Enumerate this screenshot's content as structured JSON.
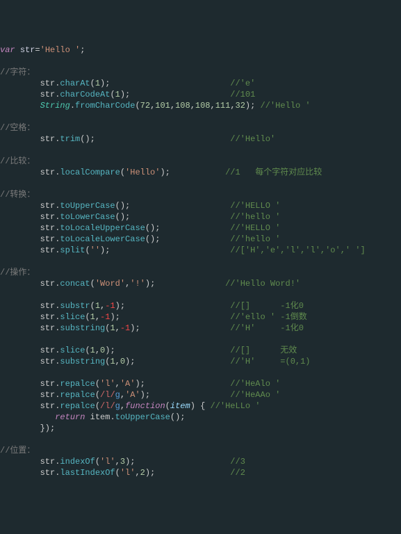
{
  "l1": {
    "kw": "var",
    "sp": " ",
    "id": "str",
    "op": "=",
    "str": "'Hello '",
    "end": ";"
  },
  "c1": "//字符：",
  "l2": {
    "pre": "        str.",
    "m": "charAt",
    "args": "(",
    "n": "1",
    "rest": ");",
    "pad": "                        ",
    "cmt": "//'e'"
  },
  "l3": {
    "pre": "        str.",
    "m": "charCodeAt",
    "args": "(",
    "n": "1",
    "rest": ");",
    "pad": "                    ",
    "cmt": "//101"
  },
  "l4": {
    "pre": "        ",
    "cls": "String",
    "dot": ".",
    "m": "fromCharCode",
    "a": "(",
    "n1": "72",
    "c": ",",
    "n2": "101",
    "n3": "108",
    "n4": "108",
    "n5": "111",
    "n6": "32",
    "rest": "); ",
    "cmt": "//'Hello '"
  },
  "c2": "//空格：",
  "l5": {
    "pre": "        str.",
    "m": "trim",
    "rest": "();",
    "pad": "                           ",
    "cmt": "//'Hello'"
  },
  "c3": "//比较：",
  "l6": {
    "pre": "        str.",
    "m": "localCompare",
    "a": "(",
    "s": "'Hello'",
    "rest": ");",
    "pad": "           ",
    "cmt": "//1   每个字符对应比较"
  },
  "c4": "//转换：",
  "l7": {
    "pre": "        str.",
    "m": "toUpperCase",
    "rest": "();",
    "pad": "                    ",
    "cmt": "//'HELLO '"
  },
  "l8": {
    "pre": "        str.",
    "m": "toLowerCase",
    "rest": "();",
    "pad": "                    ",
    "cmt": "//'hello '"
  },
  "l9": {
    "pre": "        str.",
    "m": "toLocaleUpperCase",
    "rest": "();",
    "pad": "              ",
    "cmt": "//'HELLO '"
  },
  "l10": {
    "pre": "        str.",
    "m": "toLocaleLowerCase",
    "rest": "();",
    "pad": "              ",
    "cmt": "//'hello '"
  },
  "l11": {
    "pre": "        str.",
    "m": "split",
    "a": "(",
    "s": "''",
    "rest": ");",
    "pad": "                        ",
    "cmt": "//['H','e','l','l','o',' ']"
  },
  "c5": "//操作：",
  "l12": {
    "pre": "        str.",
    "m": "concat",
    "a": "(",
    "s1": "'Word'",
    "c": ",",
    "s2": "'!'",
    "rest": ");",
    "pad": "              ",
    "cmt": "//'Hello Word!'"
  },
  "l13": {
    "pre": "        str.",
    "m": "substr",
    "a": "(",
    "n1": "1",
    "c": ",",
    "neg": "-1",
    "rest": ");",
    "pad": "                     ",
    "cmt": "//[]      -1化0"
  },
  "l14": {
    "pre": "        str.",
    "m": "slice",
    "a": "(",
    "n1": "1",
    "c": ",",
    "neg": "-1",
    "rest": ");",
    "pad": "                      ",
    "cmt": "//'ello ' -1倒数"
  },
  "l15": {
    "pre": "        str.",
    "m": "substring",
    "a": "(",
    "n1": "1",
    "c": ",",
    "neg": "-1",
    "rest": ");",
    "pad": "                  ",
    "cmt": "//'H'     -1化0"
  },
  "l16": {
    "pre": "        str.",
    "m": "slice",
    "a": "(",
    "n1": "1",
    "c": ",",
    "n2": "0",
    "rest": ");",
    "pad": "                       ",
    "cmt": "//[]      无效"
  },
  "l17": {
    "pre": "        str.",
    "m": "substring",
    "a": "(",
    "n1": "1",
    "c": ",",
    "n2": "0",
    "rest": ");",
    "pad": "                   ",
    "cmt": "//'H'     =(0,1)"
  },
  "l18": {
    "pre": "        str.",
    "m": "repalce",
    "a": "(",
    "s1": "'l'",
    "c": ",",
    "s2": "'A'",
    "rest": ");",
    "pad": "                 ",
    "cmt": "//'HeAlo '"
  },
  "l19": {
    "pre": "        str.",
    "m": "repalce",
    "a": "(",
    "re": "/l/",
    "rf": "g",
    "c": ",",
    "s": "'A'",
    "rest": ");",
    "pad": "                ",
    "cmt": "//'HeAAo '"
  },
  "l20": {
    "pre": "        str.",
    "m": "repalce",
    "a": "(",
    "re": "/l/",
    "rf": "g",
    "c": ",",
    "fnkw": "function",
    "ap": "(",
    "param": "item",
    "rp": ") { ",
    "cmt": "//'HeLLo '"
  },
  "l21": {
    "pre": "           ",
    "kw": "return",
    "sp": " item.",
    "m": "toUpperCase",
    "rest": "();"
  },
  "l22": "        });",
  "c6": "//位置：",
  "l23": {
    "pre": "        str.",
    "m": "indexOf",
    "a": "(",
    "s": "'l'",
    "c": ",",
    "n": "3",
    "rest": ");",
    "pad": "                   ",
    "cmt": "//3"
  },
  "l24": {
    "pre": "        str.",
    "m": "lastIndexOf",
    "a": "(",
    "s": "'l'",
    "c": ",",
    "n": "2",
    "rest": ");",
    "pad": "               ",
    "cmt": "//2"
  }
}
